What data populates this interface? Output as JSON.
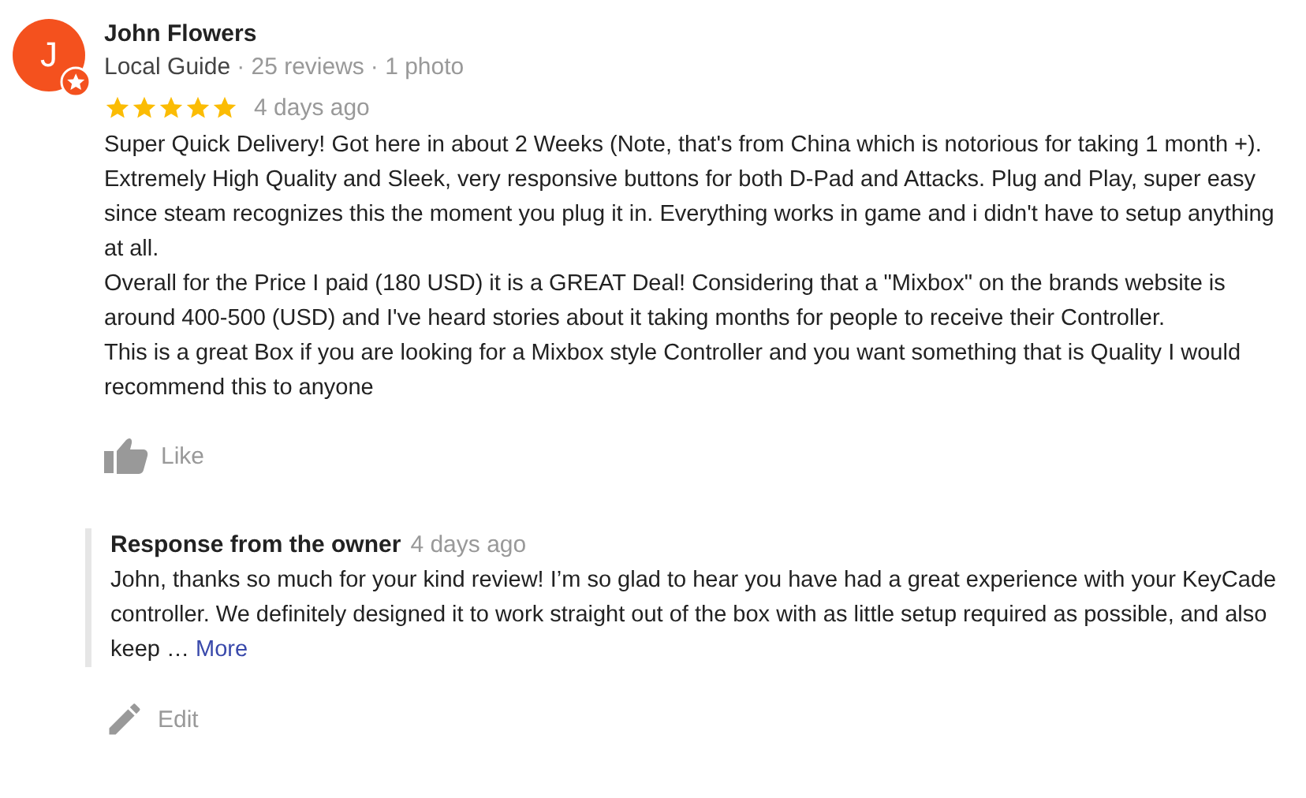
{
  "reviewer": {
    "initial": "J",
    "name": "John Flowers",
    "badge": "Local Guide",
    "reviews": "· 25 reviews",
    "photos": "· 1 photo"
  },
  "rating": {
    "stars": 5,
    "time": "4 days ago"
  },
  "review_paragraphs": [
    "Super Quick Delivery! Got here in about 2 Weeks (Note, that's from China which is notorious for taking 1 month +). Extremely High Quality and Sleek, very responsive buttons for both D-Pad and Attacks. Plug and Play, super easy since steam recognizes this the moment you plug it in. Everything works in game and i didn't have to setup anything at all.",
    "Overall for the Price I paid (180 USD) it is a GREAT Deal! Considering that a \"Mixbox\" on the brands website is around 400-500 (USD) and I've heard stories about it taking months for people to receive their Controller.",
    "This is a great Box if you are looking for a Mixbox style Controller and you want something that is Quality I would recommend this to anyone"
  ],
  "like_button": "Like",
  "owner_response": {
    "title": "Response from the owner",
    "time": "4 days ago",
    "text": "John, thanks so much for your kind review! I’m so glad to hear you have had a great experience with your KeyCade controller. We definitely designed it to work straight out of the box with as little setup required as possible, and also keep …",
    "more_link": "More"
  },
  "edit_button": "Edit"
}
